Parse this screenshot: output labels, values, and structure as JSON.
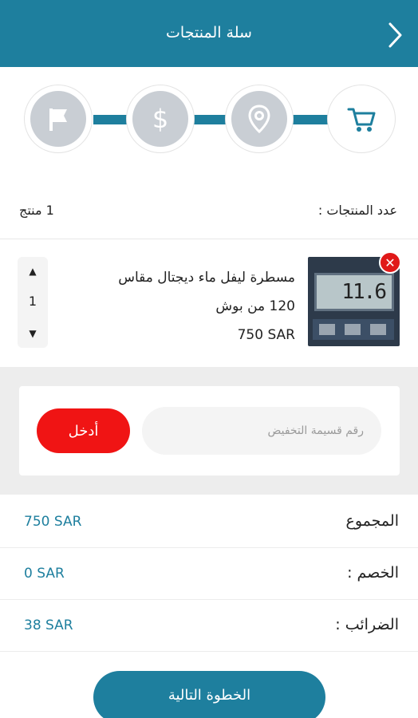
{
  "header": {
    "title": "سلة المنتجات",
    "back_icon": "chevron-right-icon"
  },
  "steps": [
    {
      "icon": "cart-icon",
      "active": true
    },
    {
      "icon": "location-pin-icon",
      "active": false
    },
    {
      "icon": "dollar-icon",
      "active": false
    },
    {
      "icon": "flag-icon",
      "active": false
    }
  ],
  "cart": {
    "count_label": "عدد المنتجات :",
    "count_value": "1 منتج"
  },
  "product": {
    "name_line1": "مسطرة ليفل ماء ديجتال مقاس",
    "name_line2": "120 من بوش",
    "price": "750 SAR",
    "quantity": "1",
    "image_digits": "11.6"
  },
  "coupon": {
    "placeholder": "رقم قسيمة التخفيض",
    "value": "",
    "apply_label": "أدخل"
  },
  "summary": {
    "total_label": "المجموع",
    "total_value": "750 SAR",
    "discount_label": "الخصم :",
    "discount_value": "0 SAR",
    "tax_label": "الضرائب :",
    "tax_value": "38 SAR"
  },
  "footer": {
    "next_label": "الخطوة التالية"
  },
  "colors": {
    "primary": "#1e7f9e",
    "danger": "#f01414",
    "step_inactive": "#c9ced4"
  }
}
